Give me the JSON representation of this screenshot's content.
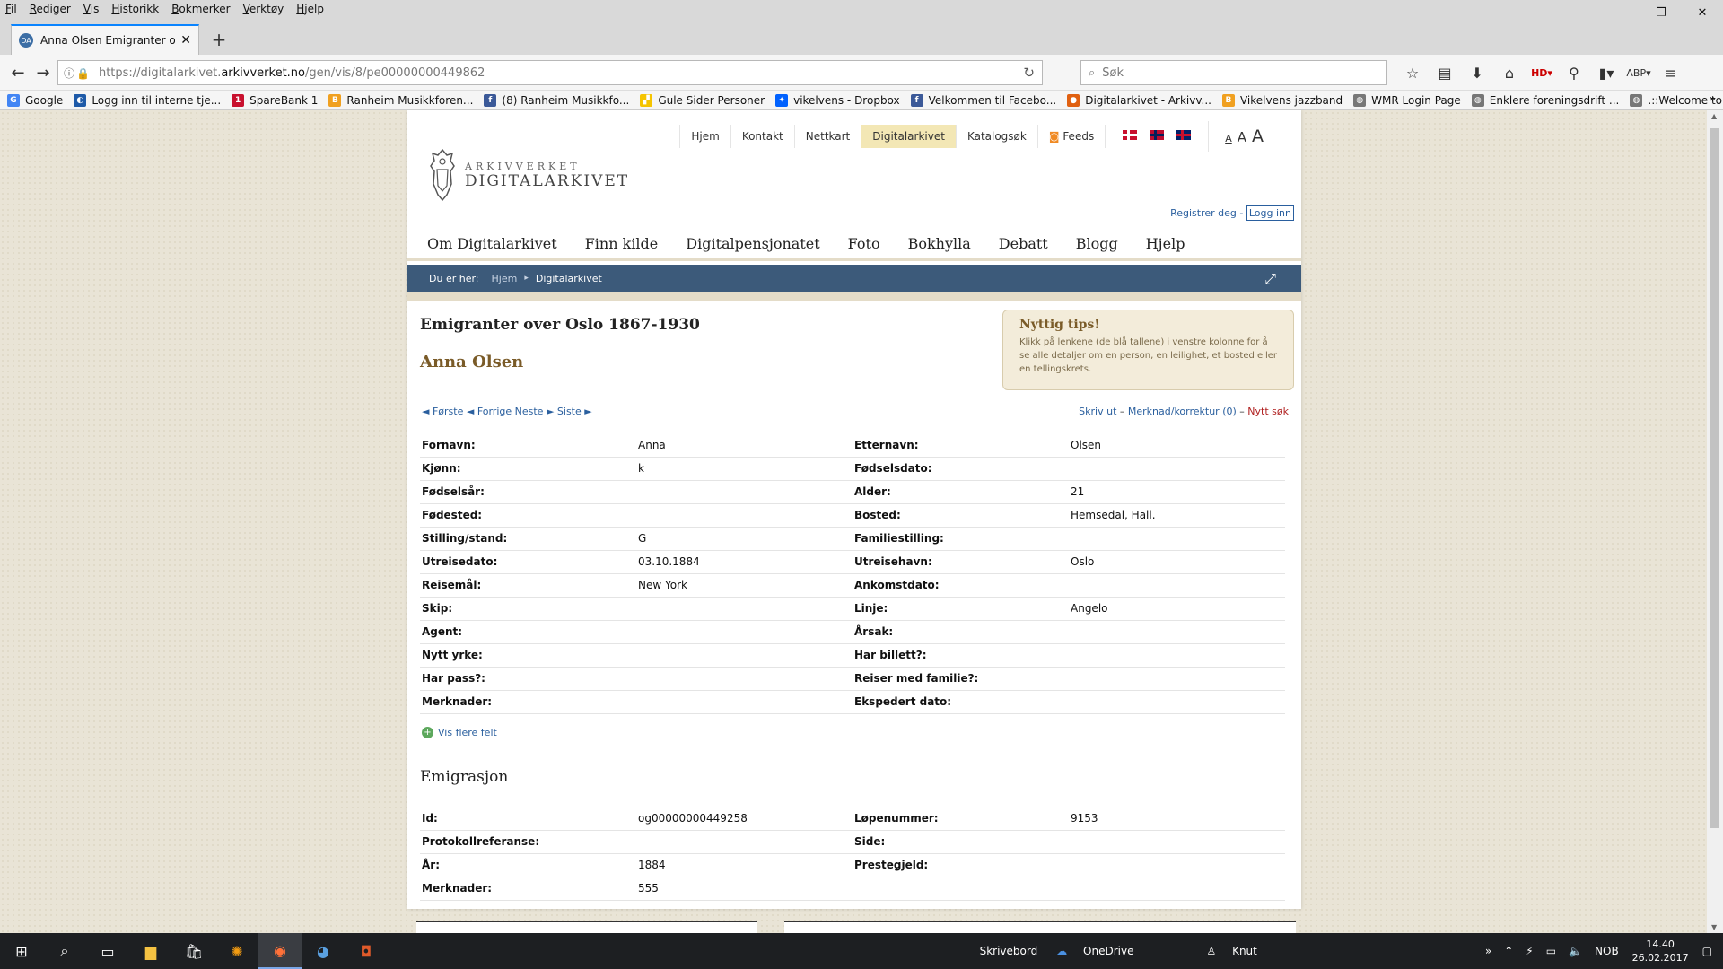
{
  "browser": {
    "menu": [
      "Fil",
      "Rediger",
      "Vis",
      "Historikk",
      "Bokmerker",
      "Verktøy",
      "Hjelp"
    ],
    "tab_title": "Anna Olsen Emigranter ov...",
    "url_prefix": "https://digitalarkivet.",
    "url_domain": "arkivverket.no",
    "url_path": "/gen/vis/8/pe00000000449862",
    "search_placeholder": "Søk",
    "bookmarks": [
      {
        "label": "Google",
        "color": "#4285f4",
        "icon": "G"
      },
      {
        "label": "Logg inn til interne tje...",
        "color": "#1e5aa8",
        "icon": "◐"
      },
      {
        "label": "SpareBank 1",
        "color": "#c8102e",
        "icon": "1"
      },
      {
        "label": "Ranheim Musikkforen...",
        "color": "#f0a020",
        "icon": "B"
      },
      {
        "label": "(8) Ranheim Musikkfo...",
        "color": "#3b5998",
        "icon": "f"
      },
      {
        "label": "Gule Sider Personer",
        "color": "#f5c400",
        "icon": "▞"
      },
      {
        "label": "vikelvens - Dropbox",
        "color": "#0061fe",
        "icon": "✦"
      },
      {
        "label": "Velkommen til Facebo...",
        "color": "#3b5998",
        "icon": "f"
      },
      {
        "label": "Digitalarkivet - Arkivv...",
        "color": "#e06010",
        "icon": "●"
      },
      {
        "label": "Vikelvens jazzband",
        "color": "#f0a020",
        "icon": "B"
      },
      {
        "label": "WMR Login Page",
        "color": "#777777",
        "icon": "◍"
      },
      {
        "label": "Enklere foreningsdrift ...",
        "color": "#777777",
        "icon": "◍"
      },
      {
        "label": ".::Welcome to the We...",
        "color": "#777777",
        "icon": "◍"
      }
    ]
  },
  "site": {
    "topnav": [
      "Hjem",
      "Kontakt",
      "Nettkart",
      "Digitalarkivet",
      "Katalogsøk",
      "Feeds"
    ],
    "font_sizes": [
      "A",
      "A",
      "A"
    ],
    "logo_small": "ARKIVVERKET",
    "logo_big": "DIGITALARKIVET",
    "register": "Registrer deg",
    "login": "Logg inn",
    "mainmenu": [
      "Om Digitalarkivet",
      "Finn kilde",
      "Digitalpensjonatet",
      "Foto",
      "Bokhylla",
      "Debatt",
      "Blogg",
      "Hjelp"
    ],
    "breadcrumb": {
      "label": "Du er her:",
      "home": "Hjem",
      "current": "Digitalarkivet"
    }
  },
  "record": {
    "source_title": "Emigranter over Oslo 1867-1930",
    "person_name": "Anna Olsen",
    "tips_title": "Nyttig tips!",
    "tips_body": "Klikk på lenkene (de blå tallene) i venstre kolonne for å se alle detaljer om en person, en leilighet, et bosted eller en tellingskrets.",
    "pager": {
      "first": "◄ Første",
      "prev": "◄ Forrige",
      "next": "Neste ►",
      "last": "Siste ►"
    },
    "actions": {
      "print": "Skriv ut",
      "correction": "Merknad/korrektur (0)",
      "new_search": "Nytt søk",
      "sep": " – "
    },
    "fields": [
      [
        "Fornavn:",
        "Anna",
        "Etternavn:",
        "Olsen"
      ],
      [
        "Kjønn:",
        "k",
        "Fødselsdato:",
        ""
      ],
      [
        "Fødselsår:",
        "",
        "Alder:",
        "21"
      ],
      [
        "Fødested:",
        "",
        "Bosted:",
        "Hemsedal, Hall."
      ],
      [
        "Stilling/stand:",
        "G",
        "Familiestilling:",
        ""
      ],
      [
        "Utreisedato:",
        "03.10.1884",
        "Utreisehavn:",
        "Oslo"
      ],
      [
        "Reisemål:",
        "New York",
        "Ankomstdato:",
        ""
      ],
      [
        "Skip:",
        "",
        "Linje:",
        "Angelo"
      ],
      [
        "Agent:",
        "",
        "Årsak:",
        ""
      ],
      [
        "Nytt yrke:",
        "",
        "Har billett?:",
        ""
      ],
      [
        "Har pass?:",
        "",
        "Reiser med familie?:",
        ""
      ],
      [
        "Merknader:",
        "",
        "Ekspedert dato:",
        ""
      ]
    ],
    "more_fields": "Vis flere felt",
    "emig_heading": "Emigrasjon",
    "emig_fields": [
      [
        "Id:",
        "og00000000449258",
        "Løpenummer:",
        "9153"
      ],
      [
        "Protokollreferanse:",
        "",
        "Side:",
        ""
      ],
      [
        "År:",
        "1884",
        "Prestegjeld:",
        ""
      ],
      [
        "Merknader:",
        "555",
        "",
        ""
      ]
    ]
  },
  "taskbar": {
    "desktop": "Skrivebord",
    "onedrive": "OneDrive",
    "user": "Knut",
    "lang": "NOB",
    "time": "14.40",
    "date": "26.02.2017"
  }
}
